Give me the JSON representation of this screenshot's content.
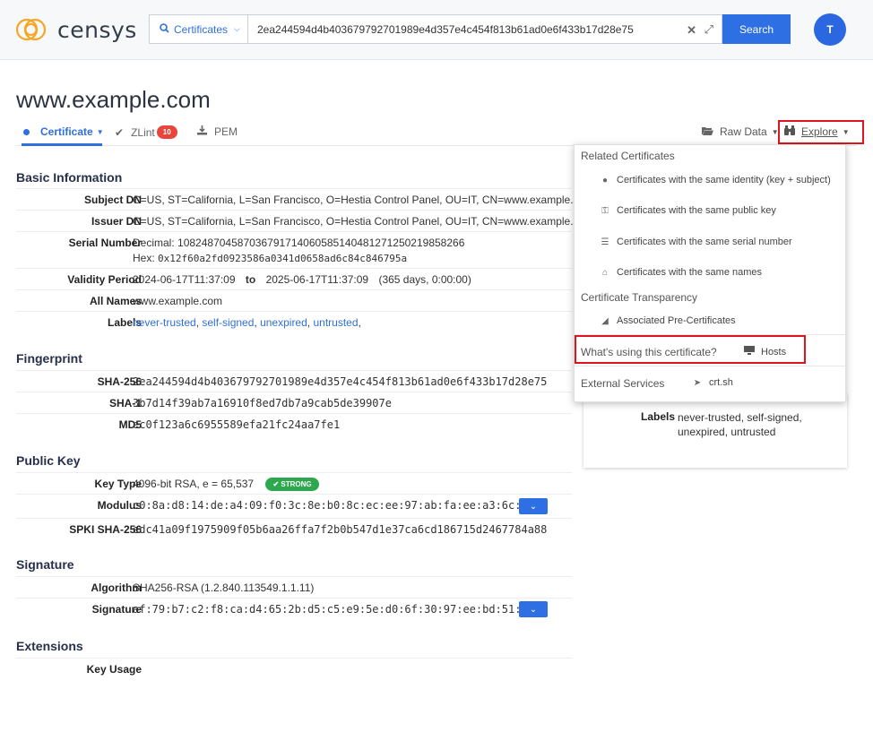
{
  "header": {
    "logo_text": "censys",
    "search_type": "Certificates",
    "search_value": "2ea244594d4b403679792701989e4d357e4c454f813b61ad0e6f433b17d28e75",
    "search_button": "Search",
    "avatar_initial": "T"
  },
  "page": {
    "title": "www.example.com"
  },
  "tabs": {
    "certificate": "Certificate",
    "zlint": "ZLint",
    "zlint_count": "10",
    "pem": "PEM",
    "raw_data": "Raw Data",
    "explore": "Explore"
  },
  "basic": {
    "title": "Basic Information",
    "subject_dn_label": "Subject DN",
    "subject_dn": "C=US, ST=California, L=San Francisco, O=Hestia Control Panel, OU=IT, CN=www.example.com",
    "issuer_dn_label": "Issuer DN",
    "issuer_dn": "C=US, ST=California, L=San Francisco, O=Hestia Control Panel, OU=IT, CN=www.example.com",
    "serial_label": "Serial Number",
    "serial_decimal_prefix": "Decimal:",
    "serial_decimal": "108248704587036791714060585140481271250219858266",
    "serial_hex_prefix": "Hex:",
    "serial_hex": "0x12f60a2fd0923586a0341d0658ad6c84c846795a",
    "validity_label": "Validity Period",
    "validity_from": "2024-06-17T11:37:09",
    "validity_to_word": "to",
    "validity_to": "2025-06-17T11:37:09",
    "validity_duration": "(365 days, 0:00:00)",
    "names_label": "All Names",
    "names_value": "www.example.com",
    "labels_label": "Labels",
    "labels": [
      "never-trusted",
      "self-signed",
      "unexpired",
      "untrusted"
    ]
  },
  "fingerprint": {
    "title": "Fingerprint",
    "sha256_label": "SHA-256",
    "sha256": "2ea244594d4b403679792701989e4d357e4c454f813b61ad0e6f433b17d28e75",
    "sha1_label": "SHA-1",
    "sha1": "3b7d14f39ab7a16910f8ed7db7a9cab5de39907e",
    "md5_label": "MD5",
    "md5": "ec0f123a6c6955589efa21fc24aa7fe1"
  },
  "public_key": {
    "title": "Public Key",
    "key_type_label": "Key Type",
    "key_type": "4096-bit RSA, e = 65,537",
    "strength": "STRONG",
    "modulus_label": "Modulus",
    "modulus": "c0:8a:d8:14:de:a4:09:f0:3c:8e:b0:8c:ec:ee:97:ab:fa:ee:a3:6c:",
    "spki_label": "SPKI SHA-256",
    "spki": "edc41a09f1975909f05b6aa26ffa7f2b0b547d1e37ca6cd186715d2467784a88"
  },
  "signature": {
    "title": "Signature",
    "algorithm_label": "Algorithm",
    "algorithm": "SHA256-RSA (1.2.840.113549.1.1.11)",
    "signature_label": "Signature",
    "signature": "af:79:b7:c2:f8:ca:d4:65:2b:d5:c5:e9:5e:d0:6f:30:97:ee:bd:51:"
  },
  "extensions": {
    "title": "Extensions",
    "key_usage_label": "Key Usage"
  },
  "side_card": {
    "labels_label": "Labels",
    "labels_line1": "never-trusted, self-signed,",
    "labels_line2": "unexpired, untrusted"
  },
  "explore_menu": {
    "related_header": "Related Certificates",
    "same_identity": "Certificates with the same identity (key + subject)",
    "same_public_key": "Certificates with the same public key",
    "same_serial": "Certificates with the same serial number",
    "same_names": "Certificates with the same names",
    "ct_header": "Certificate Transparency",
    "pre_certs": "Associated Pre-Certificates",
    "using_header": "What's using this certificate?",
    "hosts": "Hosts",
    "external_header": "External Services",
    "crtsh": "crt.sh"
  },
  "colors": {
    "accent": "#2f6fde",
    "highlight": "#e0141e",
    "strong": "#2ea84f",
    "badge": "#e8453c"
  }
}
